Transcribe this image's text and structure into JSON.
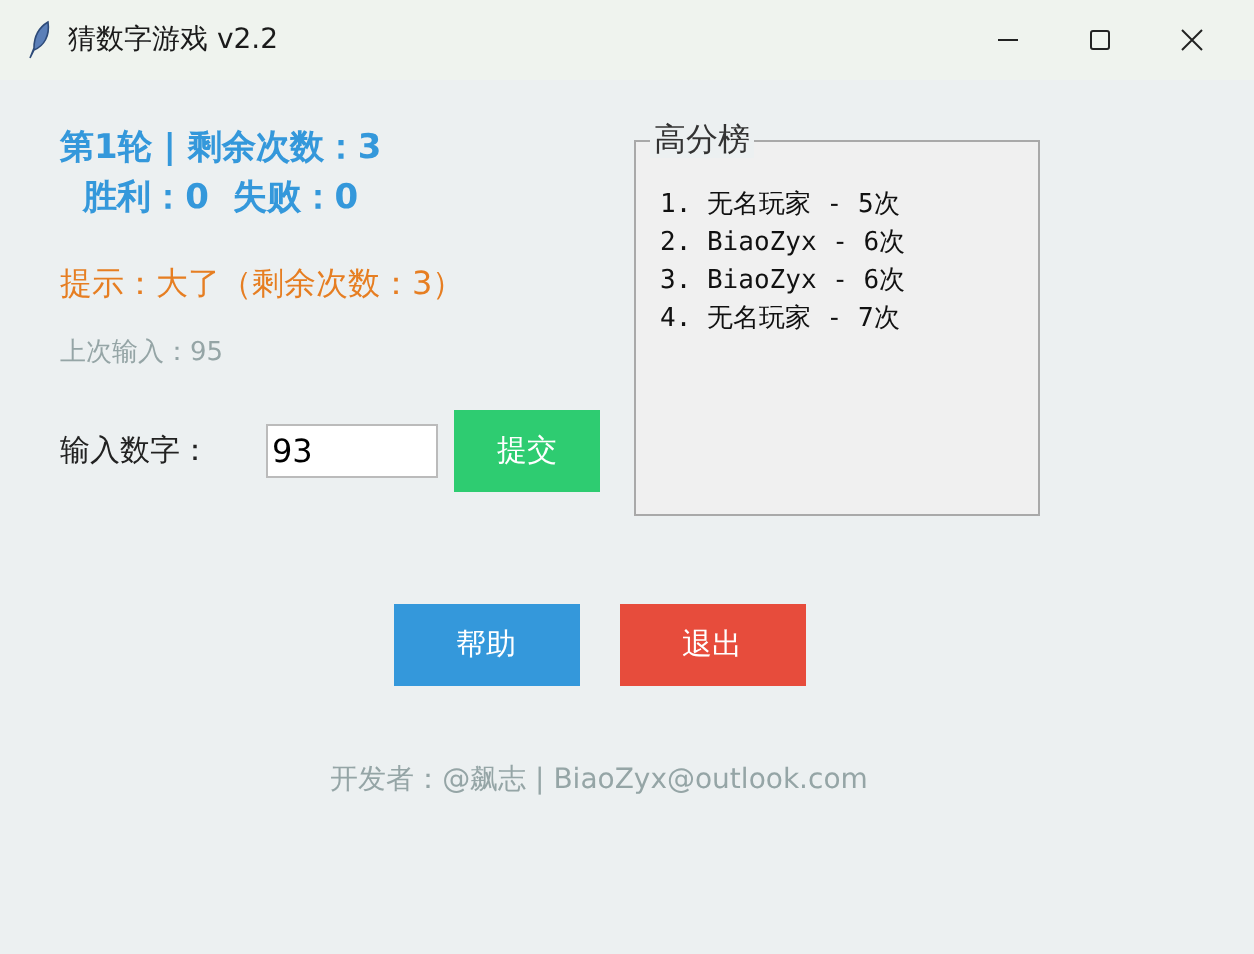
{
  "window": {
    "title": "猜数字游戏 v2.2"
  },
  "status": {
    "round_line": "第1轮 | 剩余次数：3",
    "score_line": "胜利：0  失败：0"
  },
  "hint": "提示：大了（剩余次数：3）",
  "last_input": "上次输入：95",
  "guess": {
    "label": "输入数字：",
    "value": "93",
    "submit": "提交"
  },
  "leaderboard": {
    "title": "高分榜",
    "entries": [
      "1. 无名玩家 - 5次",
      "2. BiaoZyx - 6次",
      "3. BiaoZyx - 6次",
      "4. 无名玩家 - 7次"
    ]
  },
  "buttons": [
    {
      "label": "帮助",
      "color": "#3498db"
    },
    {
      "label": "退出",
      "color": "#e74c3c"
    }
  ],
  "footer": "开发者：@飙志 | BiaoZyx@outlook.com"
}
